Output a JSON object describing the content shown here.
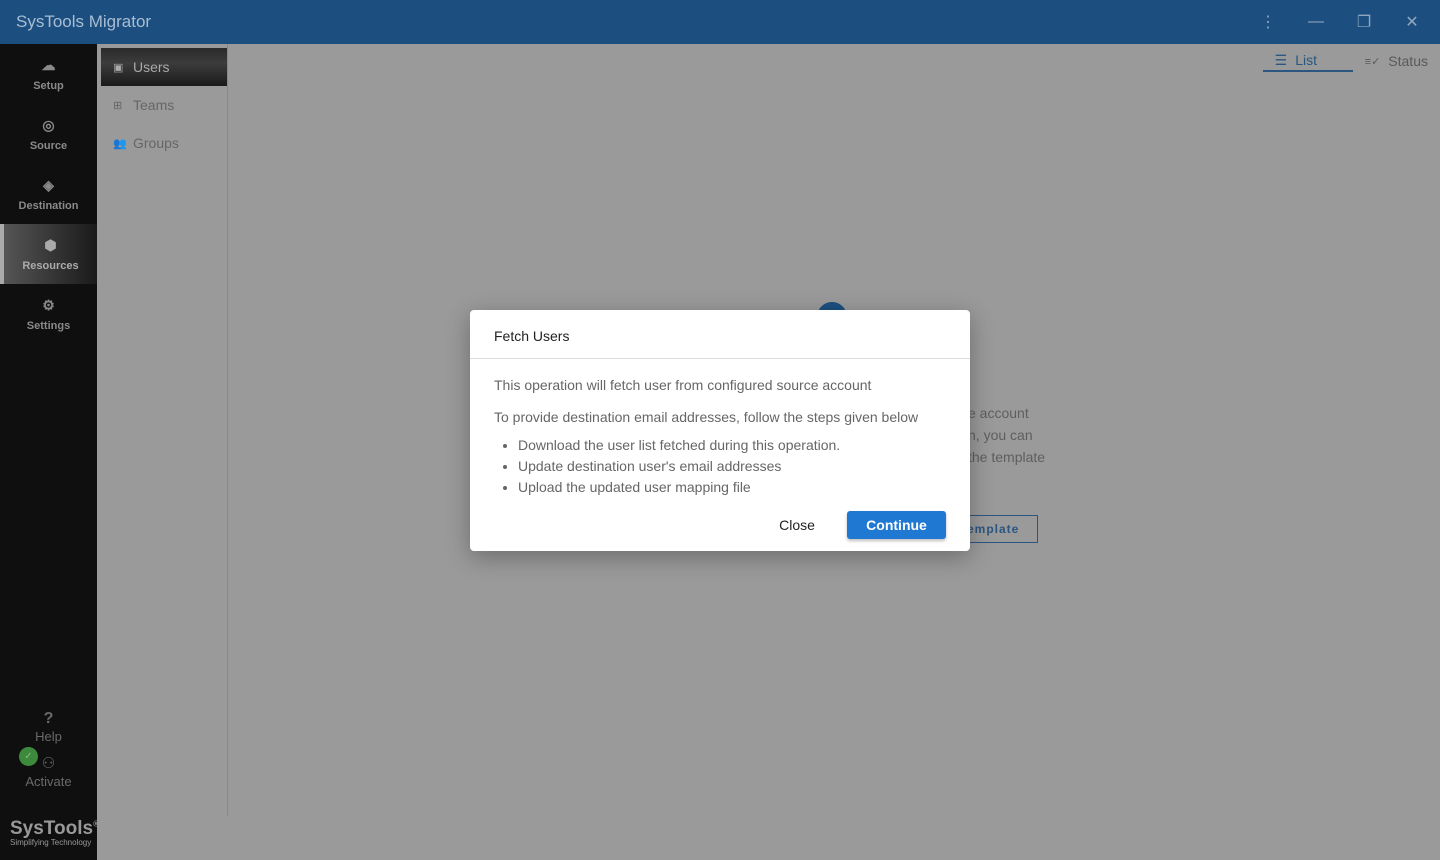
{
  "app": {
    "title": "SysTools Migrator"
  },
  "window_controls": {
    "menu": "⋮",
    "minimize": "—",
    "restore": "❐",
    "close": "✕"
  },
  "rail": {
    "items": [
      {
        "label": "Setup",
        "icon": "cloud-icon",
        "glyph": "☁"
      },
      {
        "label": "Source",
        "icon": "source-icon",
        "glyph": "◎"
      },
      {
        "label": "Destination",
        "icon": "destination-icon",
        "glyph": "◈"
      },
      {
        "label": "Resources",
        "icon": "cube-icon",
        "glyph": "⬢"
      },
      {
        "label": "Settings",
        "icon": "gear-icon",
        "glyph": "⚙"
      }
    ],
    "help": "Help",
    "help_glyph": "?",
    "activate": "Activate",
    "activate_glyph": "⚇",
    "check_glyph": "✓"
  },
  "logo": {
    "name": "SysTools",
    "tagline": "Simplifying Technology",
    "reg": "®"
  },
  "subnav": {
    "items": [
      {
        "label": "Users",
        "glyph": "▣"
      },
      {
        "label": "Teams",
        "glyph": "⊞"
      },
      {
        "label": "Groups",
        "glyph": "👥"
      }
    ]
  },
  "tabs": [
    {
      "label": "List",
      "glyph": "☰"
    },
    {
      "label": "Status",
      "glyph": "≡✓"
    }
  ],
  "background": {
    "lines": [
      "e account",
      "n, you can",
      "the template"
    ],
    "button": "emplate"
  },
  "dialog": {
    "title": "Fetch Users",
    "line1": "This operation will fetch user from configured source account",
    "line2": "To provide destination email addresses, follow the steps given below",
    "steps": [
      "Download the user list fetched during this operation.",
      "Update destination user's email addresses",
      "Upload the updated user mapping file"
    ],
    "close": "Close",
    "continue": "Continue"
  },
  "colors": {
    "titlebar": "#1c4f80",
    "primary": "#1f78d1"
  }
}
